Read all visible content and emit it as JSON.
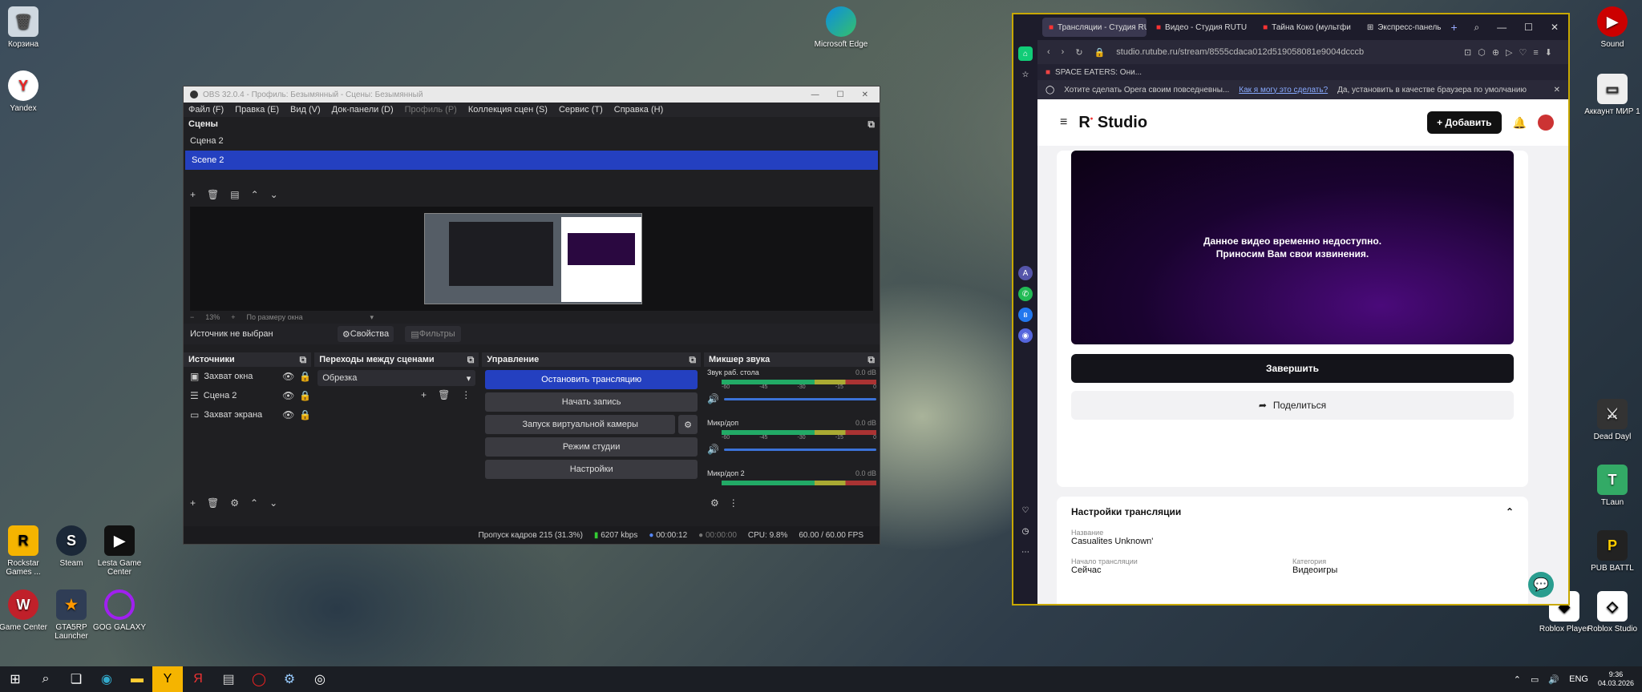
{
  "desktop": {
    "left_icons": [
      {
        "label": "Корзина"
      },
      {
        "label": "Yandex"
      },
      {
        "label": "Rockstar Games ..."
      },
      {
        "label": "Steam"
      },
      {
        "label": "Lesta Game Center"
      },
      {
        "label": "Game Center"
      },
      {
        "label": "GTA5RP Launcher"
      },
      {
        "label": "GOG GALAXY"
      }
    ],
    "right_icons": [
      {
        "label": "Microsoft Edge"
      },
      {
        "label": "Sound"
      },
      {
        "label": "Аккаунт МИР 1"
      },
      {
        "label": "Dead Dayl"
      },
      {
        "label": "TLaun"
      },
      {
        "label": "PUB BATTL"
      },
      {
        "label": "Roblox Player"
      },
      {
        "label": "Roblox Studio"
      }
    ]
  },
  "obs": {
    "title": "OBS 32.0.4 - Профиль: Безымянный - Сцены: Безымянный",
    "menu": [
      "Файл (F)",
      "Правка (E)",
      "Вид (V)",
      "Док-панели (D)",
      "Профиль (P)",
      "Коллекция сцен (S)",
      "Сервис (T)",
      "Справка (H)"
    ],
    "scenes_title": "Сцены",
    "scenes": [
      "Сцена 2",
      "Scene 2"
    ],
    "zoom": "13%",
    "zoom_mode": "По размеру окна",
    "no_source": "Источник не выбран",
    "props_btn": "Свойства",
    "filters_btn": "Фильтры",
    "sources_title": "Источники",
    "sources": [
      "Захват окна",
      "Сцена 2",
      "Захват экрана"
    ],
    "transitions_title": "Переходы между сценами",
    "transition": "Обрезка",
    "controls_title": "Управление",
    "controls": [
      "Остановить трансляцию",
      "Начать запись",
      "Запуск виртуальной камеры",
      "Режим студии",
      "Настройки"
    ],
    "mixer_title": "Микшер звука",
    "mixer": [
      {
        "name": "Звук раб. стола",
        "db": "0.0 dB"
      },
      {
        "name": "Микр/доп",
        "db": "0.0 dB"
      },
      {
        "name": "Микр/доп 2",
        "db": "0.0 dB"
      }
    ],
    "meter_scale": [
      "-60",
      "-55",
      "-50",
      "-45",
      "-40",
      "-35",
      "-30",
      "-25",
      "-20",
      "-15",
      "-10",
      "-5",
      "0"
    ],
    "status": {
      "dropped": "Пропуск кадров 215 (31.3%)",
      "bitrate": "6207 kbps",
      "stream_time": "00:00:12",
      "rec_time": "00:00:00",
      "cpu": "CPU: 9.8%",
      "fps": "60.00 / 60.00 FPS"
    }
  },
  "browser": {
    "tabs": [
      "Трансляции - Студия RU",
      "Видео - Студия RUTU",
      "Тайна Коко (мультфи",
      "Экспресс-панель"
    ],
    "url": "studio.rutube.ru/stream/8555cdaca012d519058081e9004dcccb",
    "bookmark": "SPACE EATERS: Они...",
    "notice": "Хотите сделать Opera своим повседневны...",
    "notice_link": "Как я могу это сделать?",
    "notice_btn": "Да, установить в качестве браузера по умолчанию",
    "logo": "Studio",
    "add_btn": "Добавить",
    "video_msg1": "Данное видео временно недоступно.",
    "video_msg2": "Приносим Вам свои извинения.",
    "finish_btn": "Завершить",
    "share_btn": "Поделиться",
    "settings_title": "Настройки трансляции",
    "name_label": "Название",
    "name_value": "Casualites Unknown'",
    "start_label": "Начало трансляции",
    "start_value": "Сейчас",
    "category_label": "Категория",
    "category_value": "Видеоигры"
  },
  "taskbar": {
    "lang": "ENG",
    "time": "9:36",
    "date": "04.03.2026"
  }
}
